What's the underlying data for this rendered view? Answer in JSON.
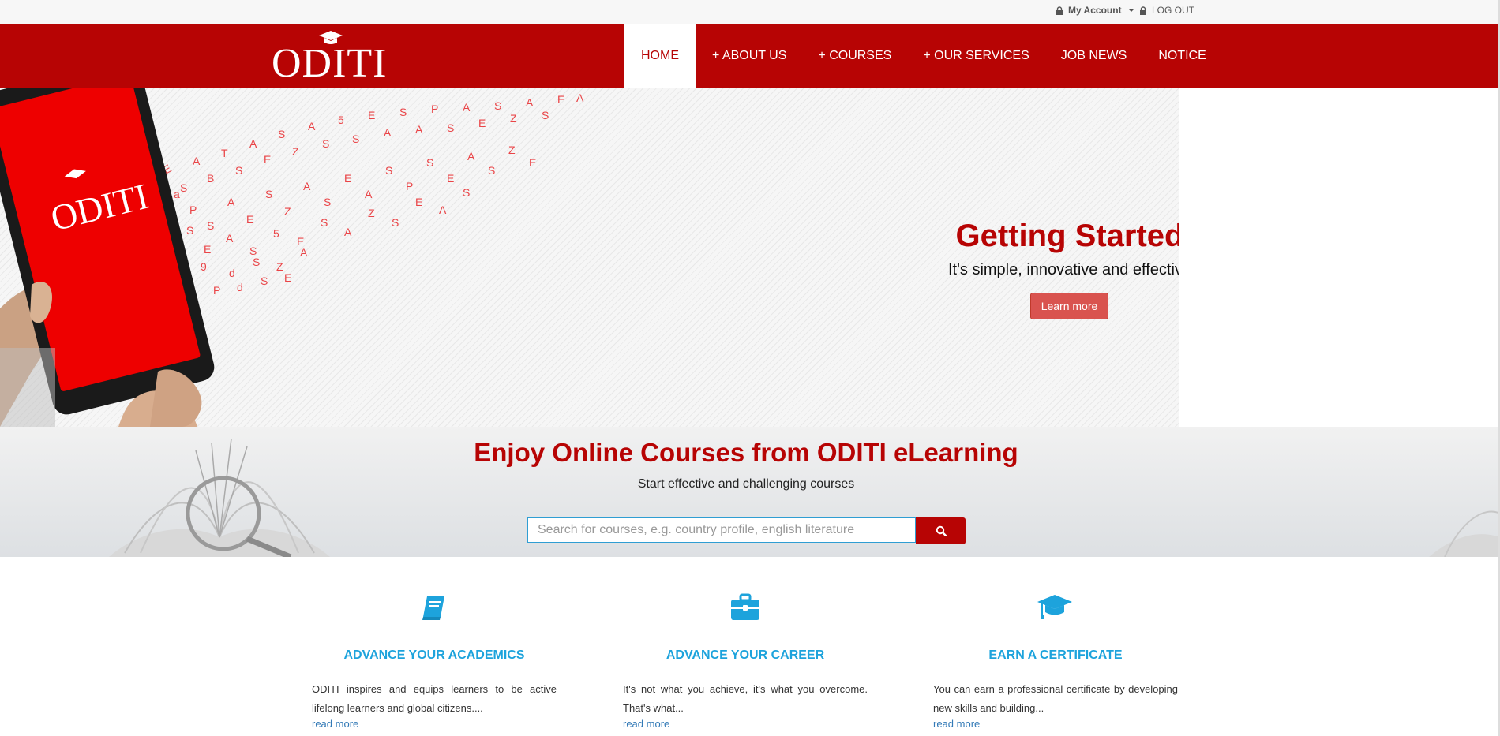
{
  "topbar": {
    "account_label": "My Account",
    "logout_label": "LOG OUT"
  },
  "brand": {
    "logo_text": "ODITI"
  },
  "nav": {
    "items": [
      {
        "label": "HOME"
      },
      {
        "label": "+ ABOUT US"
      },
      {
        "label": "+ COURSES"
      },
      {
        "label": "+ OUR SERVICES"
      },
      {
        "label": "JOB NEWS"
      },
      {
        "label": "NOTICE"
      }
    ],
    "active_index": 0
  },
  "hero": {
    "tablet_logo": "ODITI",
    "title": "Getting Started",
    "subtitle": "It's simple, innovative and effective",
    "button_label": "Learn more"
  },
  "search_band": {
    "title": "Enjoy Online Courses from ODITI eLearning",
    "subtitle": "Start effective and challenging courses",
    "placeholder": "Search for courses, e.g. country profile, english literature",
    "value": ""
  },
  "features": [
    {
      "icon": "book-icon",
      "title": "ADVANCE YOUR ACADEMICS",
      "text": "ODITI inspires and equips learners to be active lifelong learners and global citizens....",
      "link": "read more"
    },
    {
      "icon": "briefcase-icon",
      "title": "ADVANCE YOUR CAREER",
      "text": "It's not what you achieve, it's what you overcome. That's what...",
      "link": "read more"
    },
    {
      "icon": "graduation-cap-icon",
      "title": "EARN A CERTIFICATE",
      "text": "You can earn a professional certificate by developing new skills and building...",
      "link": "read more"
    }
  ],
  "colors": {
    "brand_red": "#b70404",
    "accent_blue": "#1da3dc",
    "link_blue": "#337ab7",
    "button_red": "#d9534f"
  }
}
